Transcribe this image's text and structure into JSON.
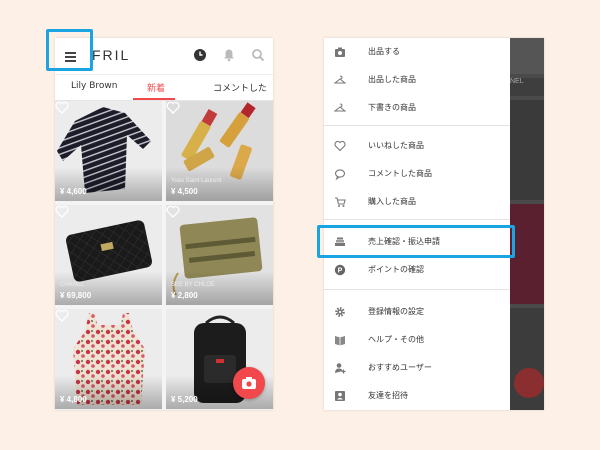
{
  "colors": {
    "background": "#fdf0e6",
    "accent": "#f0484b",
    "highlight": "#1aa4e2"
  },
  "left": {
    "logo": "FRIL",
    "icons": [
      "menu-icon",
      "clock-icon",
      "bell-icon",
      "search-icon"
    ],
    "tabs": [
      {
        "label": "Lily Brown",
        "active": false
      },
      {
        "label": "新着",
        "active": true
      },
      {
        "label": "コメントした",
        "active": false
      }
    ],
    "items": [
      {
        "brand": "",
        "price": "¥ 4,600"
      },
      {
        "brand": "Yves Saint Laurent",
        "price": "¥ 4,500"
      },
      {
        "brand": "CHANEL",
        "price": "¥ 69,800"
      },
      {
        "brand": "SEE BY CHLOE",
        "price": "¥ 2,800"
      },
      {
        "brand": "",
        "price": "¥ 4,800"
      },
      {
        "brand": "",
        "price": "¥ 5,200"
      }
    ],
    "fab_icon": "camera-icon"
  },
  "right": {
    "peek_label": "NEL",
    "menu": [
      {
        "label": "出品する",
        "icon": "camera-icon"
      },
      {
        "label": "出品した商品",
        "icon": "hanger-icon"
      },
      {
        "label": "下書きの商品",
        "icon": "hanger-icon"
      },
      {
        "label": "いいねした商品",
        "icon": "heart-icon"
      },
      {
        "label": "コメントした商品",
        "icon": "comment-icon"
      },
      {
        "label": "購入した商品",
        "icon": "cart-icon"
      },
      {
        "label": "売上確認・振込申請",
        "icon": "money-icon",
        "highlighted": true
      },
      {
        "label": "ポイントの確認",
        "icon": "points-icon"
      },
      {
        "label": "登録情報の設定",
        "icon": "gear-icon"
      },
      {
        "label": "ヘルプ・その他",
        "icon": "book-icon"
      },
      {
        "label": "おすすめユーザー",
        "icon": "user-add-icon"
      },
      {
        "label": "友達を招待",
        "icon": "invite-icon"
      }
    ]
  }
}
